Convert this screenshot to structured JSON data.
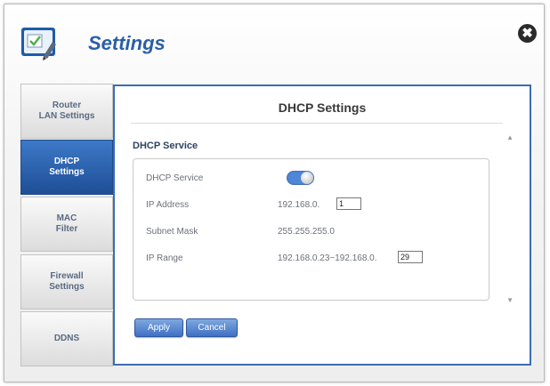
{
  "header": {
    "title": "Settings",
    "app_icon": "settings-checklist-icon",
    "close_icon": "close-icon",
    "close_glyph": "✖"
  },
  "sidebar": {
    "items": [
      {
        "label": "Router\nLAN Settings",
        "active": false
      },
      {
        "label": "DHCP\nSettings",
        "active": true
      },
      {
        "label": "MAC\nFilter",
        "active": false
      },
      {
        "label": "Firewall\nSettings",
        "active": false
      },
      {
        "label": "DDNS",
        "active": false
      }
    ]
  },
  "main": {
    "title": "DHCP Settings",
    "section_title": "DHCP Service",
    "fields": {
      "dhcp_service": {
        "label": "DHCP Service",
        "enabled": true
      },
      "ip_address": {
        "label": "IP Address",
        "prefix": "192.168.0.",
        "value": "1"
      },
      "subnet_mask": {
        "label": "Subnet Mask",
        "value": "255.255.255.0"
      },
      "ip_range": {
        "label": "IP Range",
        "prefix": "192.168.0.23~192.168.0.",
        "value": "29"
      }
    },
    "apply_label": "Apply",
    "cancel_label": "Cancel",
    "scroll_up_glyph": "▲",
    "scroll_down_glyph": "▼"
  },
  "colors": {
    "accent": "#3b6db3",
    "active_tab": "#2a5fa6",
    "toggle_on": "#4f86d8"
  }
}
